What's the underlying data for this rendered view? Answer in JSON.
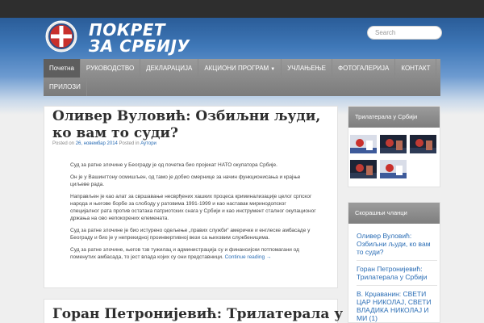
{
  "header": {
    "logo_title_line1": "ПОКРЕТ",
    "logo_title_line2": "ЗА СРБИЈУ",
    "logo_icon": "emblem-icon",
    "search_placeholder": "Search"
  },
  "nav": {
    "items": [
      {
        "label": "Почетна",
        "active": true
      },
      {
        "label": "РУКОВОДСТВО"
      },
      {
        "label": "ДЕКЛАРАЦИЈА"
      },
      {
        "label": "АКЦИОНИ ПРОГРАМ",
        "has_dropdown": true
      },
      {
        "label": "УЧЛАЊЕЊЕ"
      },
      {
        "label": "ФОТОГАЛЕРИЈА"
      },
      {
        "label": "КОНТАКТ"
      },
      {
        "label": "ПРИЛОЗИ"
      }
    ]
  },
  "post": {
    "title": "Оливер Вуловић: Озбиљни људи, ко вам то суди?",
    "meta_prefix": "Posted on",
    "date": "26, новембар 2014",
    "meta_in": "Posted in",
    "category": "Аутори",
    "paragraphs": [
      "Суд за ратне злочине у Београду је од почетка био пројекат НАТО окупатора Србије.",
      "Он је у Вашингтону осмишљен, од тамо је добио смернице за начин функционисања и крајње циљеве рада.",
      "Направљен је као алат за свршавање несврђених хашких процеса криминализације целог српског народа и његове борбе за слободу у ратовима 1991-1999 и као наставак миринодопског специјалног рата против остатака патриотских снага у Србији и као инструмент сталног окупационог држања на ово непокорених елемената.",
      "Суд за ратне злочине је био истурено одељење „правих служби“ америчке и енглеске амбасаде у Београду и био је у непрекидној проинвертивној вези са њиховим службеницима.",
      "Суд за ратне злочине, његов тзв тужилац и администрација су и финансијски потпомагани од поменутих амбасада, то јест влада којих су они представници."
    ],
    "more_link": "Continue reading →"
  },
  "post2": {
    "title": "Горан Петронијевић: Трилатерала у"
  },
  "sidebar": {
    "widget1_title": "Трилатерала у Србији",
    "widget2_title": "Скорашњи чланци",
    "recent": [
      "Оливер Вуловић: Озбиљни људи, ко вам то суди?",
      "Горан Петронијевић: Трилатерала у Србији",
      "В. Крџаванин: СВЕТИ ЦАР НИКОЛАЈ, СВЕТИ ВЛАДИКА НИКОЛАЈ И МИ (1)"
    ]
  }
}
